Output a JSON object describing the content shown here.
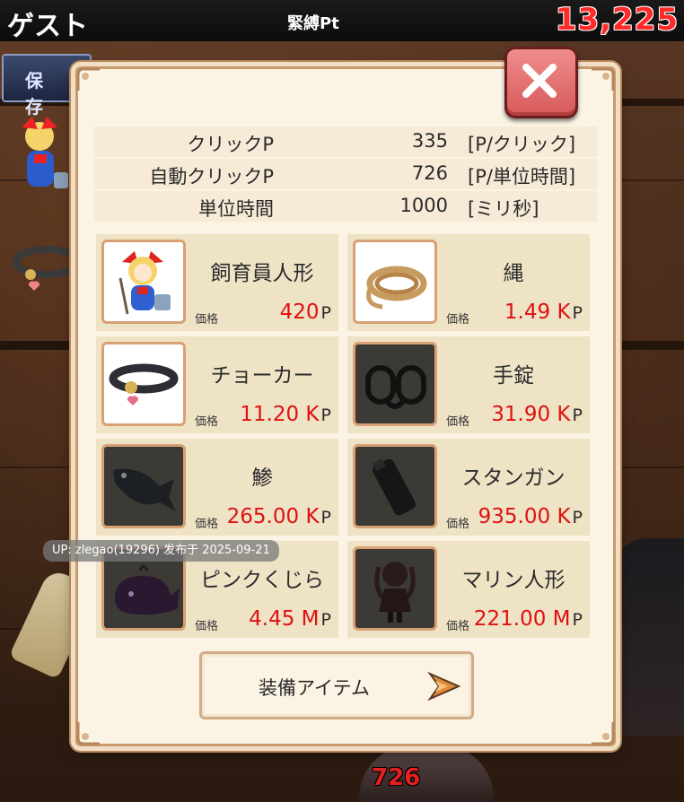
{
  "topbar": {
    "user_name": "ゲスト",
    "points_label": "緊縛Pt",
    "points_value": "13,225"
  },
  "background": {
    "storage_tab_label": "保 存"
  },
  "stats": [
    {
      "label": "クリックP",
      "value": "335",
      "unit": "[P/クリック]"
    },
    {
      "label": "自動クリックP",
      "value": "726",
      "unit": "[P/単位時間]"
    },
    {
      "label": "単位時間",
      "value": "1000",
      "unit": "[ミリ秒]"
    }
  ],
  "items": [
    {
      "name": "飼育員人形",
      "price_label": "価格",
      "price_value": "420",
      "price_unit": "P",
      "icon": "doll-keeper-icon"
    },
    {
      "name": "縄",
      "price_label": "価格",
      "price_value": "1.49 K",
      "price_unit": "P",
      "icon": "rope-icon"
    },
    {
      "name": "チョーカー",
      "price_label": "価格",
      "price_value": "11.20 K",
      "price_unit": "P",
      "icon": "choker-icon"
    },
    {
      "name": "手錠",
      "price_label": "価格",
      "price_value": "31.90 K",
      "price_unit": "P",
      "icon": "handcuffs-icon"
    },
    {
      "name": "鯵",
      "price_label": "価格",
      "price_value": "265.00 K",
      "price_unit": "P",
      "icon": "fish-icon"
    },
    {
      "name": "スタンガン",
      "price_label": "価格",
      "price_value": "935.00 K",
      "price_unit": "P",
      "icon": "stun-gun-icon"
    },
    {
      "name": "ピンクくじら",
      "price_label": "価格",
      "price_value": "4.45 M",
      "price_unit": "P",
      "icon": "whale-icon"
    },
    {
      "name": "マリン人形",
      "price_label": "価格",
      "price_value": "221.00 M",
      "price_unit": "P",
      "icon": "marine-doll-icon"
    }
  ],
  "equip_button": {
    "label": "装備アイテム"
  },
  "watermark": "UP: zlegao(19296) 发布于 2025-09-21",
  "bottom_counter": "726",
  "colors": {
    "price_red": "#e01010",
    "points_red": "#ff2a2a",
    "frame_brown": "#c79a6d",
    "close_red": "#d75a5a"
  }
}
